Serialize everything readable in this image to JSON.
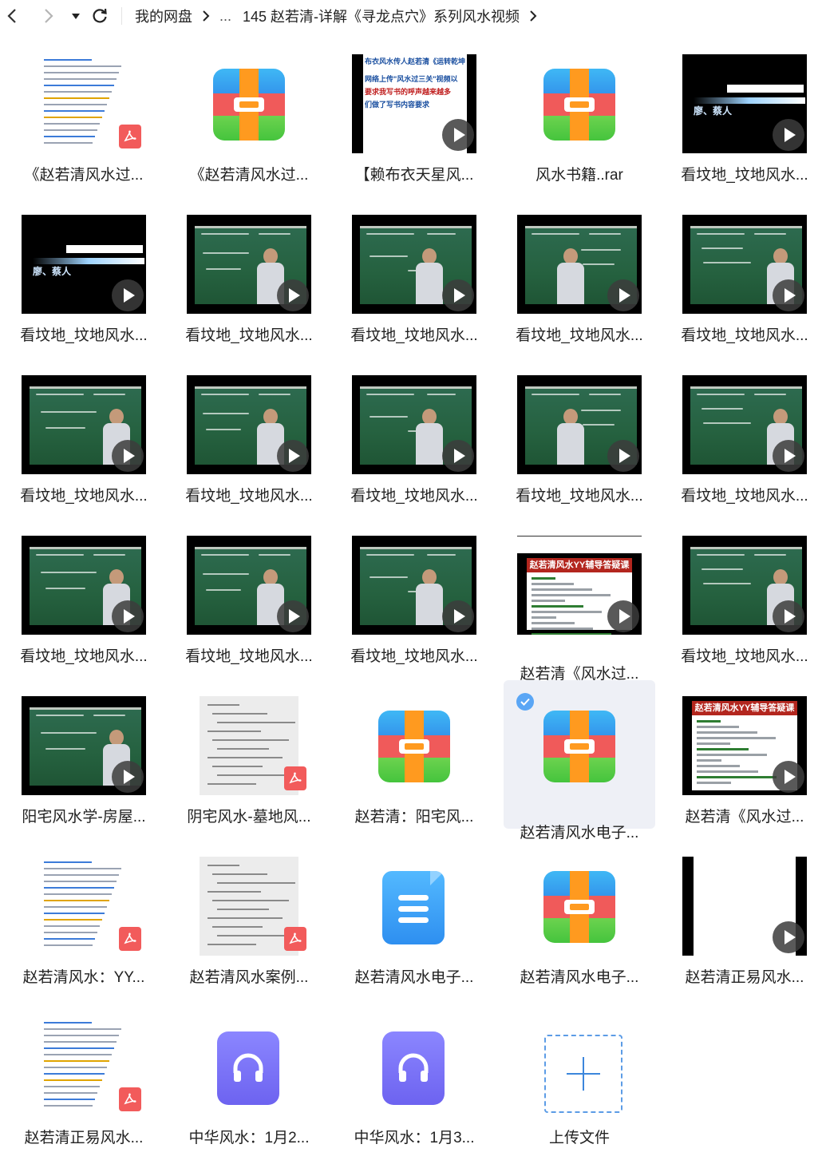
{
  "navbar": {
    "breadcrumb_root": "我的网盘",
    "breadcrumb_ellipsis": "...",
    "breadcrumb_current": "145 赵若清-详解《寻龙点穴》系列风水视频"
  },
  "files": [
    {
      "name": "《赵若清风水过...",
      "kind": "pdf"
    },
    {
      "name": "《赵若清风水过...",
      "kind": "archive"
    },
    {
      "name": "【赖布衣天星风...",
      "kind": "video-text",
      "overlay_line1": "布衣风水传人赵若清《运转乾坤",
      "overlay_line2": "网络上传\"风水过三关\"视频以",
      "overlay_line3": "要求我写书的呼声越来越多",
      "overlay_line4": "们做了写书内容要求"
    },
    {
      "name": "风水书籍..rar",
      "kind": "archive"
    },
    {
      "name": "看坟地_坟地风水...",
      "kind": "video-intro",
      "intro_text": "廖、蔡人"
    },
    {
      "name": "看坟地_坟地风水...",
      "kind": "video-intro",
      "intro_text": "廖、蔡人"
    },
    {
      "name": "看坟地_坟地风水...",
      "kind": "video-board"
    },
    {
      "name": "看坟地_坟地风水...",
      "kind": "video-board"
    },
    {
      "name": "看坟地_坟地风水...",
      "kind": "video-board"
    },
    {
      "name": "看坟地_坟地风水...",
      "kind": "video-board"
    },
    {
      "name": "看坟地_坟地风水...",
      "kind": "video-board"
    },
    {
      "name": "看坟地_坟地风水...",
      "kind": "video-board"
    },
    {
      "name": "看坟地_坟地风水...",
      "kind": "video-board"
    },
    {
      "name": "看坟地_坟地风水...",
      "kind": "video-board"
    },
    {
      "name": "看坟地_坟地风水...",
      "kind": "video-board"
    },
    {
      "name": "看坟地_坟地风水...",
      "kind": "video-board"
    },
    {
      "name": "看坟地_坟地风水...",
      "kind": "video-board"
    },
    {
      "name": "看坟地_坟地风水...",
      "kind": "video-board"
    },
    {
      "name": "赵若清《风水过...",
      "kind": "video-yy",
      "yy_title": "赵若清风水YY辅导答疑课"
    },
    {
      "name": "看坟地_坟地风水...",
      "kind": "video-board"
    },
    {
      "name": "阳宅风水学-房屋...",
      "kind": "video-board"
    },
    {
      "name": "阴宅风水-墓地风...",
      "kind": "pdf-scan"
    },
    {
      "name": "赵若清：阳宅风...",
      "kind": "archive"
    },
    {
      "name": "赵若清风水电子...",
      "kind": "archive",
      "selected": true
    },
    {
      "name": "赵若清《风水过...",
      "kind": "video-yy",
      "yy_title": "赵若清风水YY辅导答疑课"
    },
    {
      "name": "赵若清风水：YY...",
      "kind": "pdf"
    },
    {
      "name": "赵若清风水案例...",
      "kind": "pdf-scan"
    },
    {
      "name": "赵若清风水电子...",
      "kind": "doc"
    },
    {
      "name": "赵若清风水电子...",
      "kind": "archive"
    },
    {
      "name": "赵若清正易风水...",
      "kind": "video-blank"
    },
    {
      "name": "赵若清正易风水...",
      "kind": "pdf"
    },
    {
      "name": "中华风水：1月2...",
      "kind": "audio"
    },
    {
      "name": "中华风水：1月3...",
      "kind": "audio"
    },
    {
      "name": "上传文件",
      "kind": "upload"
    }
  ],
  "colors": {
    "selected_bg": "#eef0f6",
    "check_blue": "#5aa6f5",
    "pdf_red": "#f25b5b",
    "upload_blue": "#3c86dc"
  }
}
